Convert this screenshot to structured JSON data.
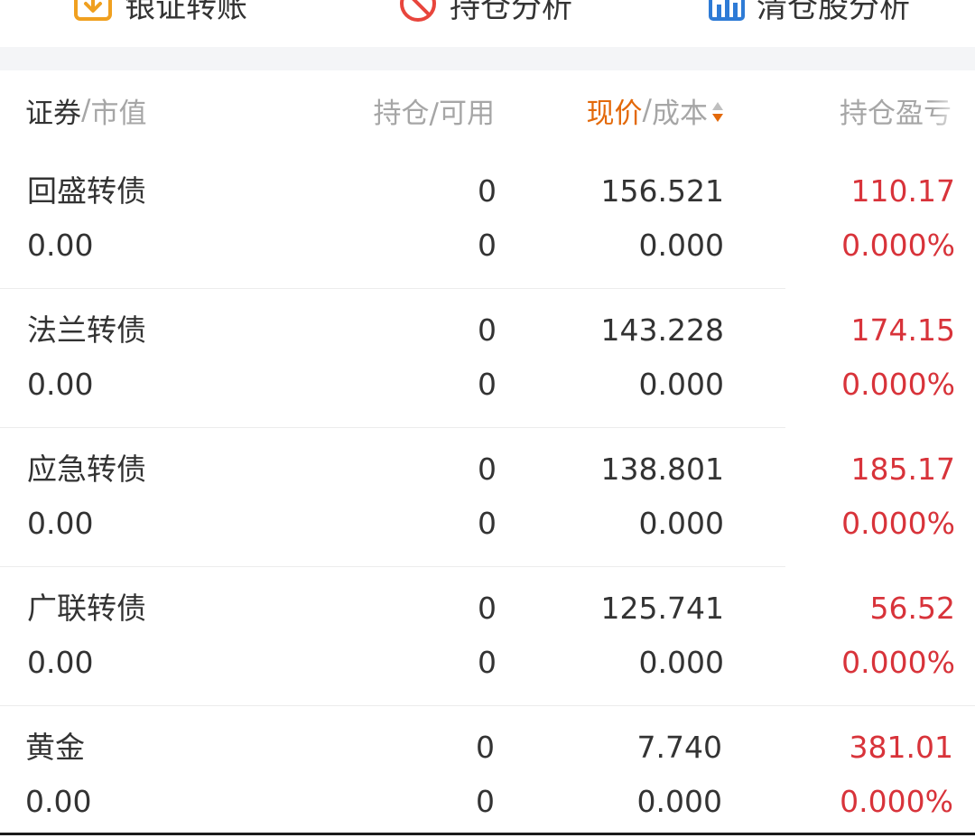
{
  "toolbar": {
    "items": [
      {
        "label": "银证转账",
        "icon": "transfer-icon",
        "color": "#f0a020"
      },
      {
        "label": "持仓分析",
        "icon": "no-entry-icon",
        "color": "#e8453c"
      },
      {
        "label": "清仓股分析",
        "icon": "bar-chart-icon",
        "color": "#2e7bd6"
      }
    ]
  },
  "table": {
    "headers": {
      "security": "证券",
      "market_value": "市值",
      "position": "持仓/可用",
      "price": "现价",
      "cost": "成本",
      "pnl": "持仓盈亏"
    },
    "sep": "/",
    "active_color": "#e3690a",
    "rows": [
      {
        "name": "回盛转债",
        "market_value": "0.00",
        "position": "0",
        "available": "0",
        "price": "156.521",
        "cost": "0.000",
        "pnl": "110.17",
        "pnl_pct": "0.000%"
      },
      {
        "name": "法兰转债",
        "market_value": "0.00",
        "position": "0",
        "available": "0",
        "price": "143.228",
        "cost": "0.000",
        "pnl": "174.15",
        "pnl_pct": "0.000%"
      },
      {
        "name": "应急转债",
        "market_value": "0.00",
        "position": "0",
        "available": "0",
        "price": "138.801",
        "cost": "0.000",
        "pnl": "185.17",
        "pnl_pct": "0.000%"
      },
      {
        "name": "广联转债",
        "market_value": "0.00",
        "position": "0",
        "available": "0",
        "price": "125.741",
        "cost": "0.000",
        "pnl": "56.52",
        "pnl_pct": "0.000%"
      },
      {
        "name": "黄金",
        "market_value": "0.00",
        "position": "0",
        "available": "0",
        "price": "7.740",
        "cost": "0.000",
        "pnl": "381.01",
        "pnl_pct": "0.000%"
      }
    ]
  },
  "colors": {
    "profit": "#d8333a",
    "text": "#333333",
    "muted": "#a6a6a6"
  }
}
